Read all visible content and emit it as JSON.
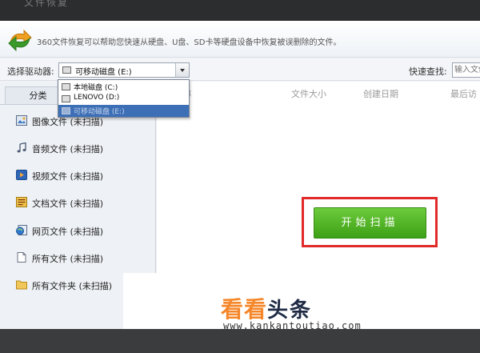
{
  "window": {
    "title": "文件恢复"
  },
  "banner": {
    "description": "360文件恢复可以帮助您快速从硬盘、U盘、SD卡等硬盘设备中恢复被误删除的文件。"
  },
  "toolbar": {
    "drive_label": "选择驱动器:",
    "drive_selected": "可移动磁盘 (E:)",
    "search_label": "快速查找:",
    "search_placeholder": "输入文件名"
  },
  "drive_options": [
    "本地磁盘 (C:)",
    "LENOVO (D:)",
    "可移动磁盘 (E:)"
  ],
  "sidebar": {
    "tab_label": "分类",
    "items": [
      {
        "label": "图像文件 (未扫描)",
        "icon": "image-icon"
      },
      {
        "label": "音频文件 (未扫描)",
        "icon": "music-icon"
      },
      {
        "label": "视频文件 (未扫描)",
        "icon": "video-icon"
      },
      {
        "label": "文档文件 (未扫描)",
        "icon": "document-icon"
      },
      {
        "label": "网页文件 (未扫描)",
        "icon": "webpage-icon"
      },
      {
        "label": "所有文件 (未扫描)",
        "icon": "file-icon"
      },
      {
        "label": "所有文件夹 (未扫描)",
        "icon": "folder-icon"
      }
    ]
  },
  "table": {
    "columns": [
      "称",
      "文件大小",
      "创建日期",
      "最后访"
    ]
  },
  "scan": {
    "button_label": "开始扫描"
  },
  "watermark": {
    "brand_a": "看看",
    "brand_b": "头条",
    "url": "www.kankantoutiao.com"
  },
  "colors": {
    "scan_green": "#4db526",
    "highlight_red": "#e12b2b",
    "selection_blue": "#3d6fb6",
    "brand_orange": "#f5872a"
  }
}
